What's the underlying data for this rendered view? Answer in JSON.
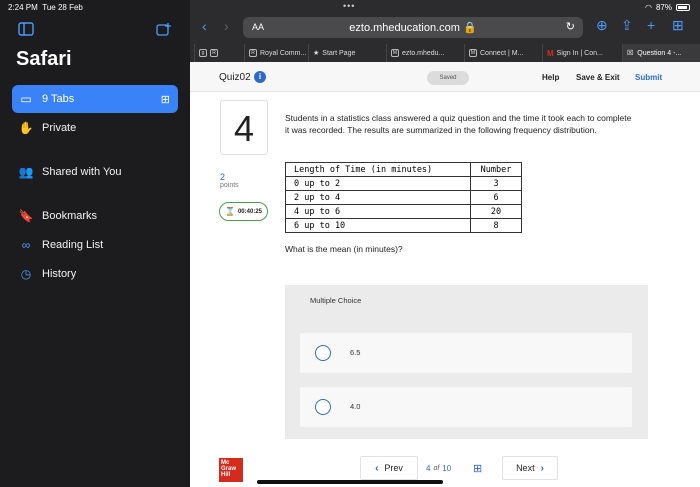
{
  "status": {
    "time": "2:24 PM",
    "date": "Tue 28 Feb",
    "battery": "87%"
  },
  "sidebar": {
    "title": "Safari",
    "items": [
      {
        "label": "9 Tabs",
        "icon": "tabs-icon",
        "active": true
      },
      {
        "label": "Private",
        "icon": "hand-icon"
      },
      {
        "label": "Shared with You",
        "icon": "people-icon"
      },
      {
        "label": "Bookmarks",
        "icon": "bookmark-icon"
      },
      {
        "label": "Reading List",
        "icon": "glasses-icon"
      },
      {
        "label": "History",
        "icon": "clock-icon"
      }
    ]
  },
  "browser": {
    "address_prefix": "AA",
    "url": "ezto.mheducation.com",
    "tabs": [
      {
        "label": "R"
      },
      {
        "label": "Royal Comm..."
      },
      {
        "label": "Start Page"
      },
      {
        "label": "ezto.mhedu..."
      },
      {
        "label": "Connect | M..."
      },
      {
        "label": "Sign In | Con..."
      },
      {
        "label": "Question 4 -..."
      }
    ]
  },
  "header": {
    "quiz_title": "Quiz02",
    "saved": "Saved",
    "help": "Help",
    "save_exit": "Save & Exit",
    "submit": "Submit"
  },
  "question": {
    "number": "4",
    "points_value": "2",
    "points_label": "points",
    "timer": "00:40:25",
    "text": "Students in a statistics class answered a quiz question and the time it took each to complete it was recorded. The results are summarized in the following frequency distribution.",
    "table": {
      "headers": [
        "Length of Time (in minutes)",
        "Number"
      ],
      "rows": [
        [
          "0 up to 2",
          "3"
        ],
        [
          "2 up to 4",
          "6"
        ],
        [
          "4 up to 6",
          "20"
        ],
        [
          "6 up to 10",
          "8"
        ]
      ]
    },
    "ask": "What is the mean (in minutes)?",
    "choice_type": "Multiple Choice",
    "choices": [
      "6.5",
      "4.0"
    ]
  },
  "footer": {
    "logo_text": "Mc Graw Hill",
    "prev": "Prev",
    "current_page": "4",
    "of": "of",
    "total_pages": "10",
    "next": "Next"
  }
}
